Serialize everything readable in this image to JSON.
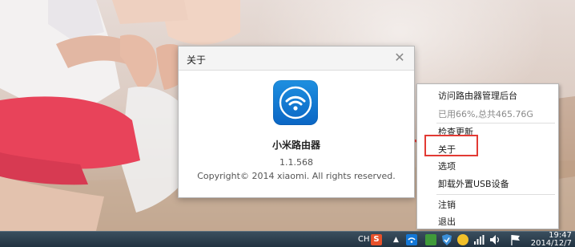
{
  "about_dialog": {
    "title": "关于",
    "app_name": "小米路由器",
    "version": "1.1.568",
    "copyright": "Copyright© 2014 xiaomi. All rights reserved.",
    "close_glyph": "✕",
    "logo_icon": "wifi-icon",
    "accent_color": "#1377d6"
  },
  "tray_menu": {
    "items": [
      {
        "label": "访问路由器管理后台",
        "enabled": true
      },
      {
        "label": "已用66%,总共465.76G",
        "enabled": false
      },
      {
        "label": "检查更新",
        "enabled": true
      },
      {
        "label": "关于",
        "enabled": true,
        "highlighted": true
      },
      {
        "label": "选项",
        "enabled": true
      },
      {
        "label": "卸载外置USB设备",
        "enabled": true
      },
      {
        "label": "注销",
        "enabled": true
      },
      {
        "label": "退出",
        "enabled": true
      }
    ],
    "highlight_color": "#e23a34"
  },
  "taskbar": {
    "input_indicator": "CH",
    "sogou_icon_label": "S",
    "clock_time": "19:47",
    "clock_date": "2014/12/7",
    "tray_icons": [
      "show-hidden-icons",
      "wifi-icon",
      "shield-icon",
      "app-icon",
      "qq-icon",
      "network-icon",
      "volume-icon",
      "flag-icon"
    ]
  }
}
